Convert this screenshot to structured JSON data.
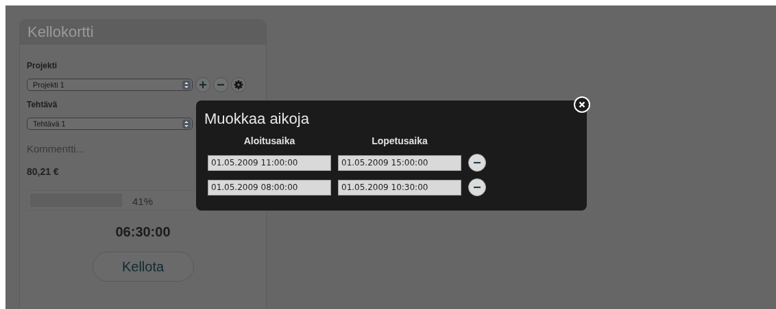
{
  "card": {
    "title": "Kellokortti",
    "fields": [
      {
        "label": "Projekti",
        "value": "Projekti 1"
      },
      {
        "label": "Tehtävä",
        "value": "Tehtävä 1"
      }
    ],
    "comment": {
      "placeholder": "Kommentti..."
    },
    "amount": "80,21 €",
    "progress": {
      "level": 0.41,
      "reading": "41%"
    },
    "timer": "06:30:00",
    "button": "Kellota"
  },
  "dialog": {
    "title": "Muokkaa aikoja",
    "columns": [
      "Aloitusaika",
      "Lopetusaika"
    ],
    "rows": [
      {
        "start": "01.05.2009 11:00:00",
        "end": "01.05.2009 15:00:00"
      },
      {
        "start": "01.05.2009 08:00:00",
        "end": "01.05.2009 10:30:00"
      }
    ]
  }
}
